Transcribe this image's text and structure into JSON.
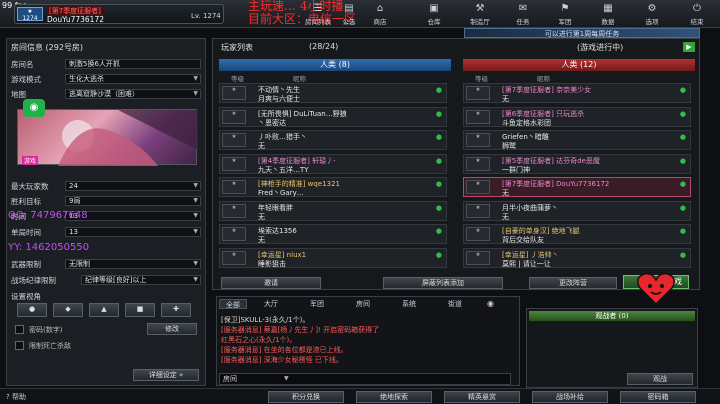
{
  "fps": "99 fps",
  "user": {
    "rank_label": "1274",
    "tag": "[第7季度征服者]",
    "name": "DouYu7736172",
    "level": "Lv. 1274"
  },
  "overlay": {
    "line1": "主玩速…       4小时播",
    "line2": "目前大区：电信一区"
  },
  "nav": {
    "room": "房间列表",
    "hall": "公告",
    "shop": "商店",
    "store": "仓库",
    "craft": "制造厅",
    "task": "任务",
    "army": "军团",
    "data": "数据",
    "opt": "选项",
    "exit": "结束"
  },
  "promo": "可以进行第1周每周任务",
  "room": {
    "header": "房间信息",
    "room_no": "(292号房)",
    "fields": [
      {
        "label": "房间名",
        "value": "刺激5换6人开抓"
      },
      {
        "label": "游戏模式",
        "value": "生化大逃杀"
      },
      {
        "label": "地图",
        "value": "逃离窟静沙漠（困难）"
      }
    ],
    "map_tag": "游戏",
    "settings": [
      {
        "label": "最大玩家数",
        "value": "24"
      },
      {
        "label": "胜利目标",
        "value": "9局"
      },
      {
        "label": "时间",
        "value": "13"
      },
      {
        "label": "单局时间",
        "value": "13"
      },
      {
        "label": "武器限制",
        "value": "无限制"
      },
      {
        "label": "战场纪律限制",
        "value": "纪律等级[良好]以上"
      }
    ],
    "view_label": "设置视角",
    "password_label": "密码(数字)",
    "password_btn": "修改",
    "limit_label": "限制死亡杀敌",
    "details_btn": "详细设定",
    "help": "帮助"
  },
  "watermarks": {
    "w1": "QQ: 747967648",
    "w2": "YY: 1462050550"
  },
  "player_list": {
    "title": "玩家列表",
    "count": "(28/24)",
    "status": "(游戏进行中)",
    "col_level": "等级",
    "col_name": "昵称",
    "team_a": "人类 (8)",
    "team_b": "人类 (12)",
    "team_a_players": [
      {
        "clan": "不动情丶先生",
        "name": "月爽与六便士",
        "clan_color": "#e8e8e8"
      },
      {
        "clan": "[无所畏惧] DuLiTuan…野狼",
        "name": "丶恩密达",
        "clan_color": "#e8e8e8"
      },
      {
        "clan": "丿卟败…猎手丶",
        "name": "无",
        "clan_color": "#e8e8e8"
      },
      {
        "clan": "[第4季度征服者] 轩辕丿-",
        "name": "九天丶五洋…TY",
        "clan_color": "#e88ac6"
      },
      {
        "clan": "[神枪手的精准] wqe1321",
        "name": "Fred丶Gary…",
        "clan_color": "#e8c46a"
      },
      {
        "clan": "年轻眼看胖",
        "name": "无",
        "clan_color": "#e8e8e8"
      },
      {
        "clan": "埃索达1356",
        "name": "无",
        "clan_color": "#e8e8e8"
      },
      {
        "clan": "[幸运星] niux1",
        "name": "睡影狙击",
        "clan_color": "#e8c46a"
      }
    ],
    "team_b_players": [
      {
        "clan": "[第7季度征服者] 奈奈美少女",
        "name": "无",
        "clan_color": "#e88ac6"
      },
      {
        "clan": "[第6季度征服者] 只玩逃杀",
        "name": "斗鱼定格水彩团",
        "clan_color": "#e88ac6"
      },
      {
        "clan": "Griefen丶暗雕",
        "name": "狮鹫",
        "clan_color": "#e8e8e8"
      },
      {
        "clan": "[第5季度征服者] 达芬奇de恶魔",
        "name": "一群门神",
        "clan_color": "#e88ac6"
      },
      {
        "clan": "[第7季度征服者] DouYu7736172",
        "name": "无",
        "clan_color": "#e88ac6"
      },
      {
        "clan": "月半小夜曲蒲萝丶",
        "name": "无",
        "clan_color": "#e8e8e8"
      },
      {
        "clan": "[自豪的单身汉] 绝地飞腿",
        "name": "背后交给队友",
        "clan_color": "#e8c46a"
      },
      {
        "clan": "[幸运星] 丿浩帅丶",
        "name": "莫熙 | 请让一让",
        "clan_color": "#e8c46a"
      }
    ],
    "invite_btn": "邀请",
    "block_btn": "屏蔽列表添加",
    "change_btn": "更改阵营",
    "start_btn": "游戏"
  },
  "chat": {
    "tabs": [
      "全部",
      "大厅",
      "军团",
      "房间",
      "系统",
      "街道"
    ],
    "lines": [
      {
        "text": "[保卫]SKULL-3(永久/1个)。",
        "color": "#d8d8d8"
      },
      {
        "text": "[服务器消息] 蔡嘉[杨丿先生丿]! 开启密码箱获得了",
        "color": "#ff5a5a"
      },
      {
        "text": "红黑石之心(永久/1个)。",
        "color": "#ff5a5a"
      },
      {
        "text": "[服务器消息] 在坐的各位都是渣已上线。",
        "color": "#ff5a5a"
      },
      {
        "text": "[服务器消息] 深海少女秘楞怪 已下线。",
        "color": "#ff5a5a"
      }
    ],
    "input_value": "房间"
  },
  "spectators": {
    "header": "观战者 (0)",
    "button": "观战"
  },
  "bottom": {
    "b1": "积分兑换",
    "b2": "绝地探索",
    "b3": "精英悬赏",
    "b4": "战场补给",
    "b5": "密码箱"
  }
}
